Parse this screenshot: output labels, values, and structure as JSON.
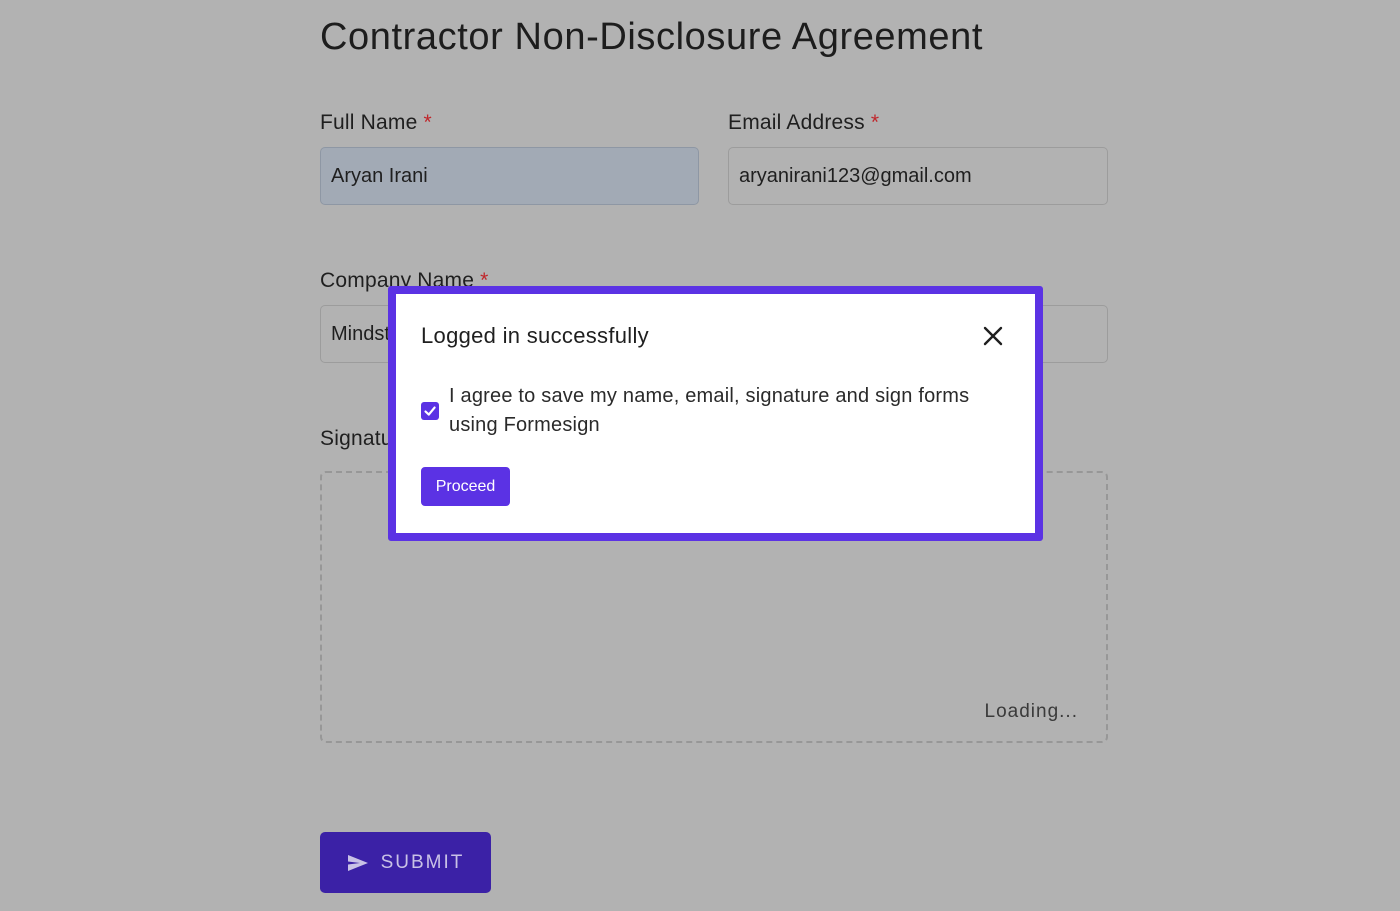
{
  "form": {
    "title": "Contractor Non-Disclosure Agreement",
    "full_name": {
      "label": "Full Name",
      "required_mark": "*",
      "value": "Aryan Irani"
    },
    "email": {
      "label": "Email Address",
      "required_mark": "*",
      "value": "aryanirani123@gmail.com"
    },
    "company": {
      "label": "Company Name",
      "required_mark": "*",
      "value": "Mindst"
    },
    "signature": {
      "label": "Signatu",
      "loading_text": "Loading..."
    },
    "submit_label": "SUBMIT"
  },
  "modal": {
    "title": "Logged in successfully",
    "consent_text": "I agree to save my name, email, signature and sign forms using Formesign",
    "consent_checked": true,
    "proceed_label": "Proceed"
  },
  "colors": {
    "accent": "#5b32e4",
    "submit_bg": "#3b21a6",
    "required": "#c0262b",
    "overlay": "#b2b2b2"
  },
  "icons": {
    "close": "close-icon",
    "check": "check-icon",
    "submit": "send-icon"
  }
}
